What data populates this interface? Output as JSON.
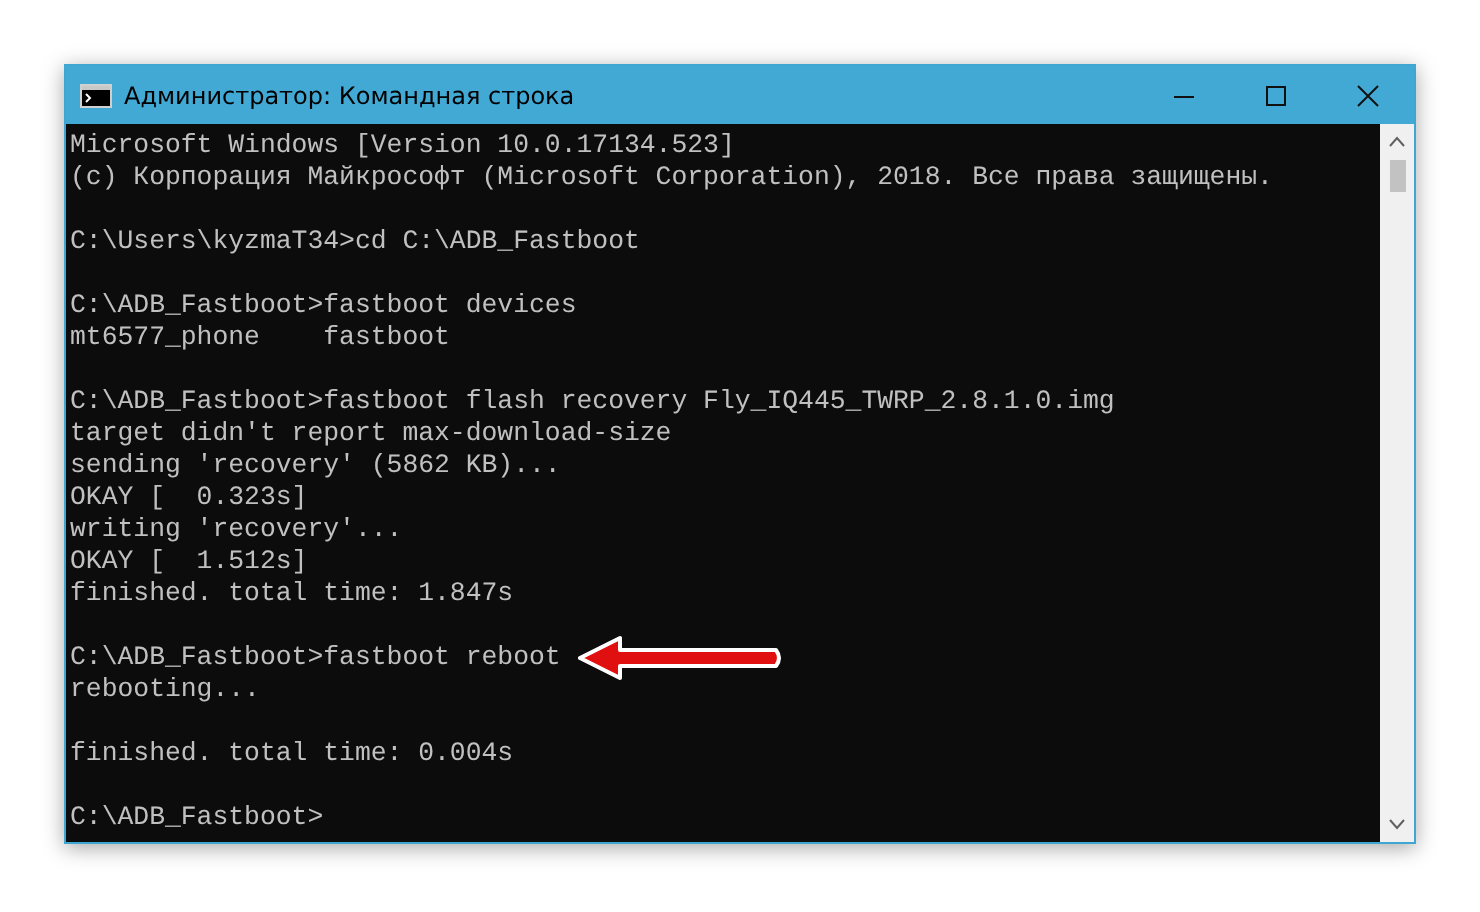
{
  "window": {
    "title": "Администратор: Командная строка"
  },
  "console": {
    "blocks": [
      [
        {
          "text": "Microsoft Windows [Version 10.0.17134.523]",
          "arrow": false
        },
        {
          "text": "(c) Корпорация Майкрософт (Microsoft Corporation), 2018. Все права защищены.",
          "arrow": false
        }
      ],
      [
        {
          "text": "C:\\Users\\kyzmaT34>cd C:\\ADB_Fastboot",
          "arrow": false
        }
      ],
      [
        {
          "text": "C:\\ADB_Fastboot>fastboot devices",
          "arrow": false
        },
        {
          "text": "mt6577_phone    fastboot",
          "arrow": false
        }
      ],
      [
        {
          "text": "C:\\ADB_Fastboot>fastboot flash recovery Fly_IQ445_TWRP_2.8.1.0.img",
          "arrow": false
        },
        {
          "text": "target didn't report max-download-size",
          "arrow": false
        },
        {
          "text": "sending 'recovery' (5862 KB)...",
          "arrow": false
        },
        {
          "text": "OKAY [  0.323s]",
          "arrow": false
        },
        {
          "text": "writing 'recovery'...",
          "arrow": false
        },
        {
          "text": "OKAY [  1.512s]",
          "arrow": false
        },
        {
          "text": "finished. total time: 1.847s",
          "arrow": false
        }
      ],
      [
        {
          "text": "C:\\ADB_Fastboot>fastboot reboot",
          "arrow": true
        },
        {
          "text": "rebooting...",
          "arrow": false
        }
      ],
      [
        {
          "text": "finished. total time: 0.004s",
          "arrow": false
        }
      ],
      [
        {
          "text": "C:\\ADB_Fastboot>",
          "arrow": false
        }
      ]
    ]
  }
}
